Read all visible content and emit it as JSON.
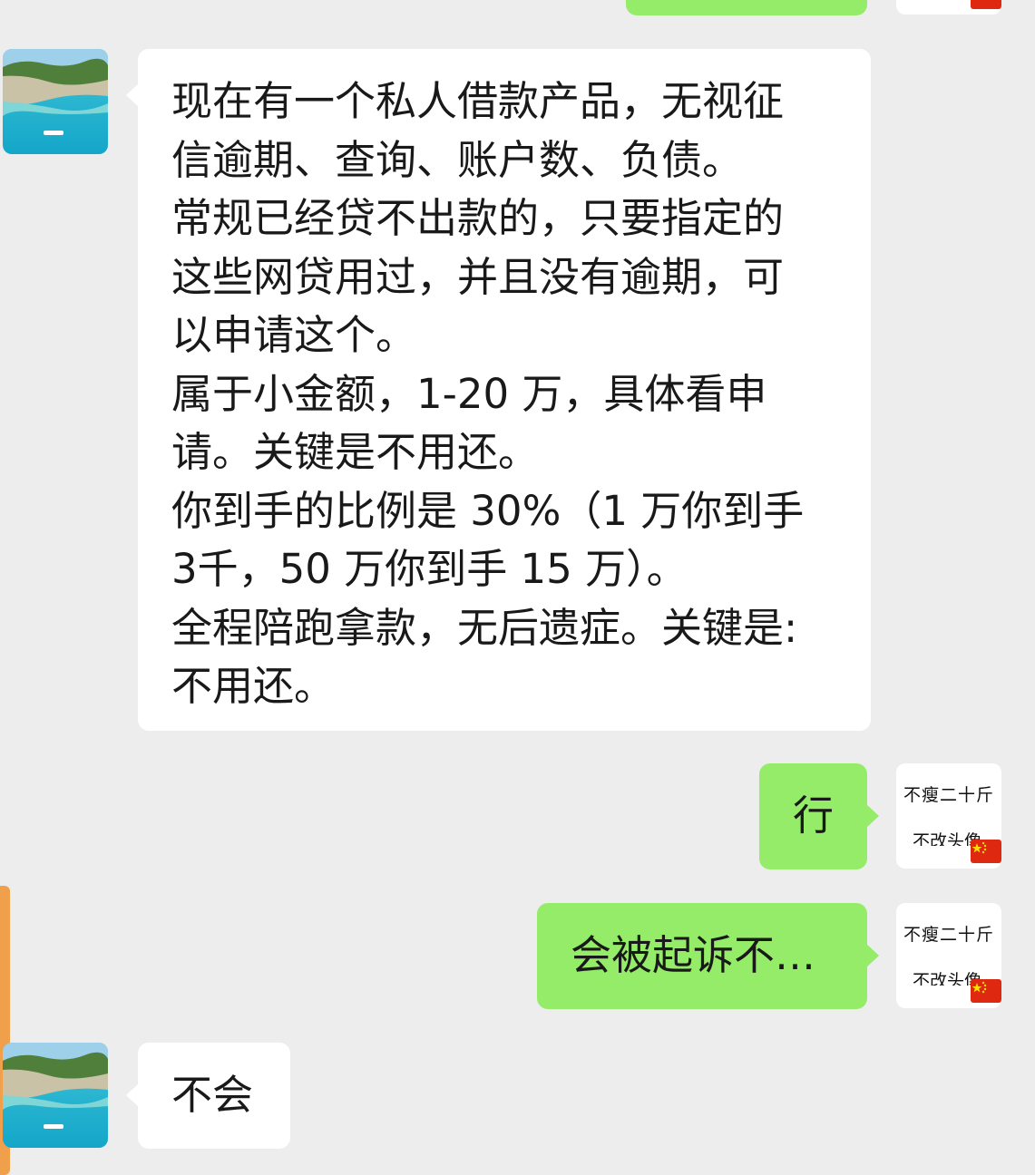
{
  "chat": {
    "messages": [
      {
        "side": "left",
        "text": "现在有一个私人借款产品，无视征\n信逾期、查询、账户数、负债。\n常规已经贷不出款的，只要指定的\n这些网贷用过，并且没有逾期，可\n以申请这个。\n属于小金额，1-20 万，具体看申\n请。关键是不用还。\n你到手的比例是 30%（1 万你到手\n3千，50 万你到手 15 万）。\n全程陪跑拿款，无后遗症。关键是:\n不用还。"
      },
      {
        "side": "right",
        "text": "行"
      },
      {
        "side": "right",
        "text": "会被起诉不…"
      },
      {
        "side": "left",
        "text": "不会"
      }
    ]
  },
  "self_avatar": {
    "line1": "不瘦二十斤",
    "line2": "不改头像",
    "flag": "china-flag-icon"
  },
  "colors": {
    "background": "#ededed",
    "incoming_bubble": "#ffffff",
    "outgoing_bubble": "#95ec69",
    "accent_bar": "#f0a04b"
  }
}
